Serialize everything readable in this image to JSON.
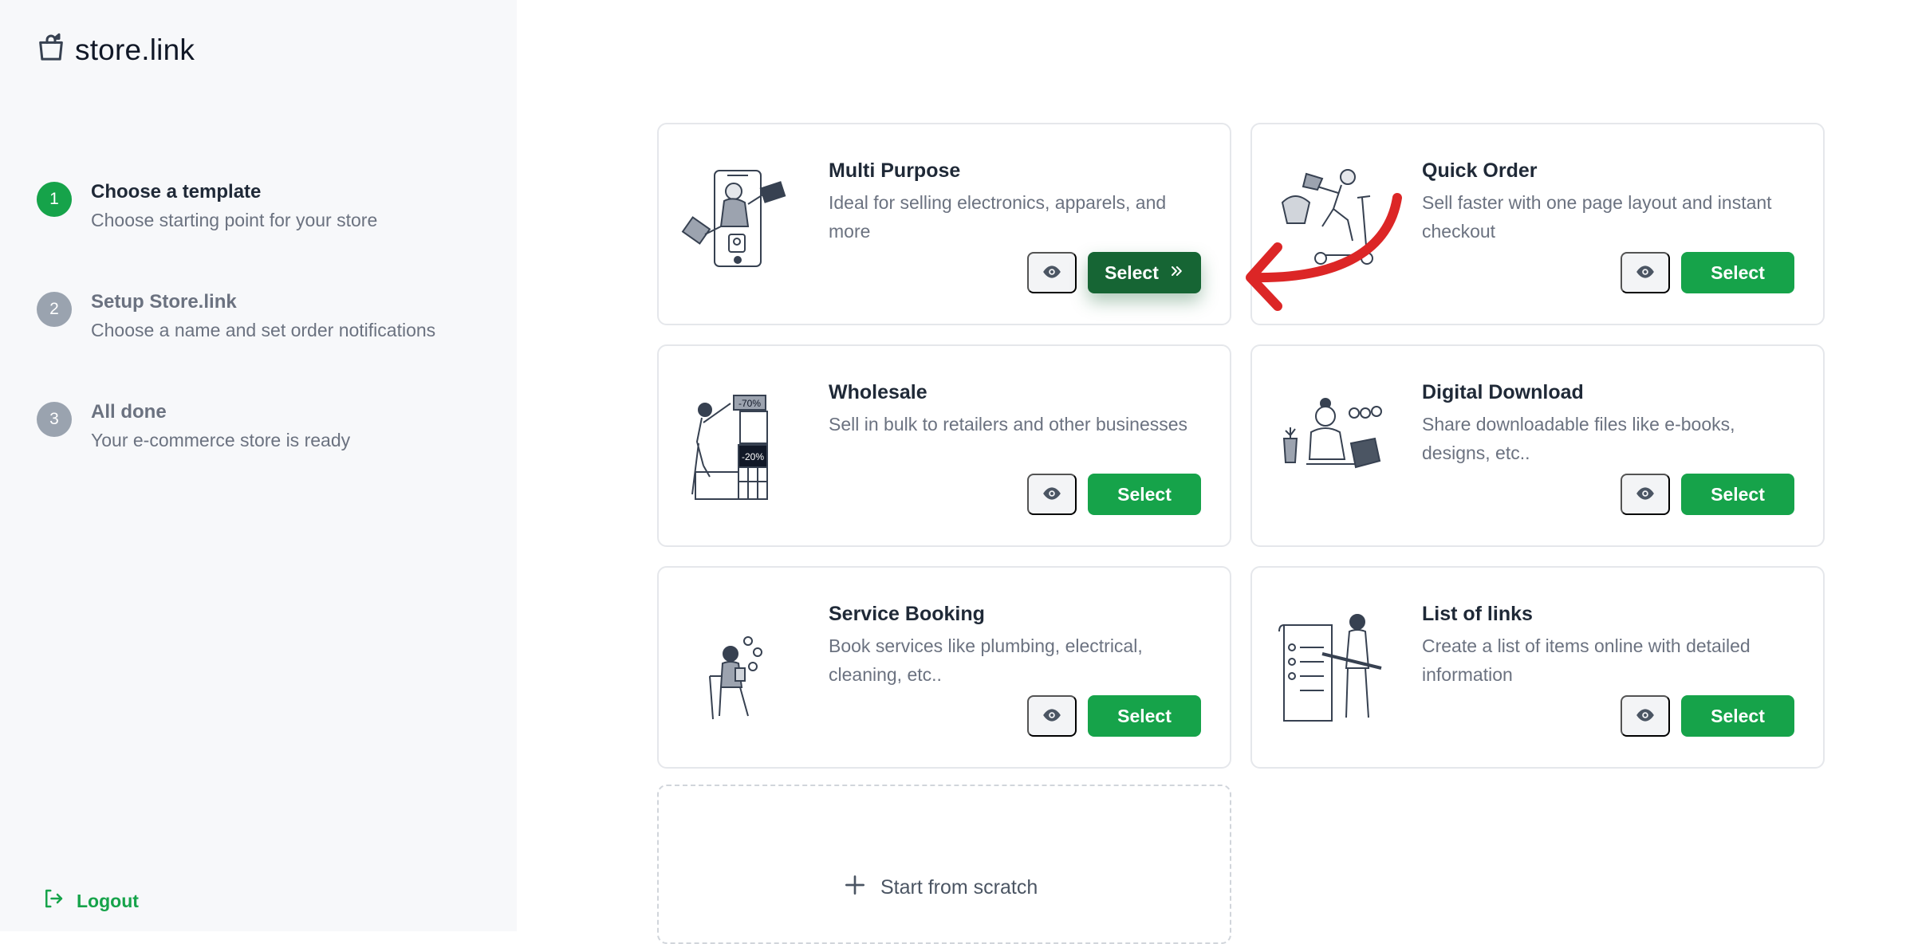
{
  "brand": {
    "name": "store.link",
    "icon": "shopping-bag-icon"
  },
  "steps": [
    {
      "number": "1",
      "title": "Choose a template",
      "description": "Choose starting point for your store",
      "state": "active"
    },
    {
      "number": "2",
      "title": "Setup Store.link",
      "description": "Choose a name and set order notifications",
      "state": "inactive"
    },
    {
      "number": "3",
      "title": "All done",
      "description": "Your e-commerce store is ready",
      "state": "inactive"
    }
  ],
  "logout": {
    "label": "Logout",
    "icon": "logout-icon"
  },
  "templates": [
    {
      "title": "Multi Purpose",
      "description": "Ideal for selling electronics, apparels, and more",
      "select_label": "Select",
      "preview_icon": "eye-icon",
      "hovered": true
    },
    {
      "title": "Quick Order",
      "description": "Sell faster with one page layout and instant checkout",
      "select_label": "Select",
      "preview_icon": "eye-icon"
    },
    {
      "title": "Wholesale",
      "description": "Sell in bulk to retailers and other businesses",
      "select_label": "Select",
      "preview_icon": "eye-icon"
    },
    {
      "title": "Digital Download",
      "description": "Share downloadable files like e-books, designs, etc..",
      "select_label": "Select",
      "preview_icon": "eye-icon"
    },
    {
      "title": "Service Booking",
      "description": "Book services like plumbing, electrical, cleaning, etc..",
      "select_label": "Select",
      "preview_icon": "eye-icon"
    },
    {
      "title": "List of links",
      "description": "Create a list of items online with detailed information",
      "select_label": "Select",
      "preview_icon": "eye-icon"
    }
  ],
  "illustration_text": {
    "wholesale_top": "-70%",
    "wholesale_mid": "-20%"
  },
  "scratch": {
    "label": "Start from scratch",
    "icon": "plus-icon"
  },
  "colors": {
    "accent": "#16a34a",
    "accent_dark": "#166534",
    "sidebar_bg": "#f7f8fa",
    "annotation_arrow": "#dc2626"
  }
}
